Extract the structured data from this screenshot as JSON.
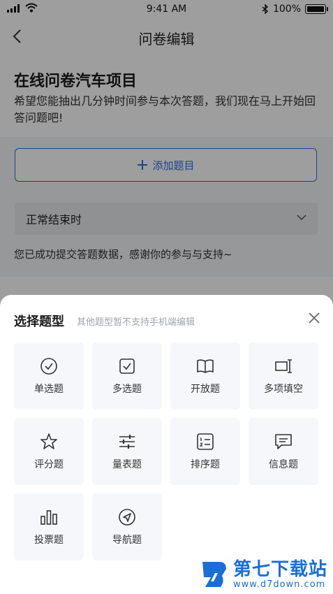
{
  "status": {
    "time": "9:41 AM",
    "battery": "100%"
  },
  "nav": {
    "title": "问卷编辑"
  },
  "survey": {
    "title": "在线问卷汽车项目",
    "description": "希望您能抽出几分钟时间参与本次答题，我们现在马上开始回答问题吧!",
    "add_label": "添加题目",
    "end_type": "正常结束时",
    "end_message": "您已成功提交答题数据，感谢你的参与与支持~"
  },
  "sheet": {
    "title": "选择题型",
    "subtitle": "其他题型暂不支持手机端编辑",
    "types": [
      {
        "label": "单选题",
        "icon": "check-circle-icon"
      },
      {
        "label": "多选题",
        "icon": "check-square-icon"
      },
      {
        "label": "开放题",
        "icon": "open-book-icon"
      },
      {
        "label": "多项填空",
        "icon": "text-cursor-icon"
      },
      {
        "label": "评分题",
        "icon": "star-icon"
      },
      {
        "label": "量表题",
        "icon": "sliders-icon"
      },
      {
        "label": "排序题",
        "icon": "ordered-list-icon"
      },
      {
        "label": "信息题",
        "icon": "message-icon"
      },
      {
        "label": "投票题",
        "icon": "bar-chart-icon"
      },
      {
        "label": "导航题",
        "icon": "navigation-icon"
      }
    ]
  },
  "watermark": {
    "name": "第七下载站",
    "url": "www.d7down.com"
  },
  "colors": {
    "accent": "#2f6fe0",
    "watermark": "#1a6fd6"
  }
}
